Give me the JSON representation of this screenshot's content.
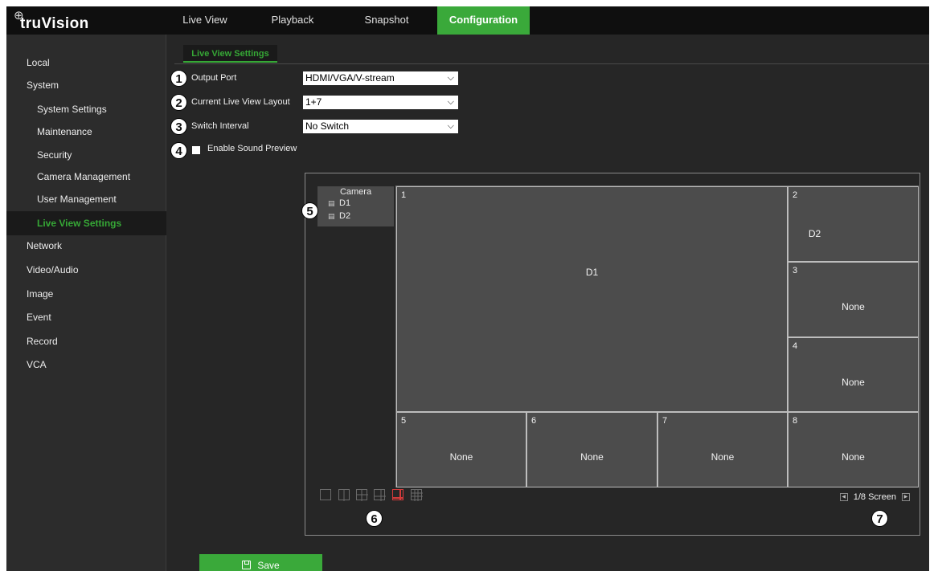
{
  "app": {
    "logo_text": "truVision"
  },
  "nav": {
    "tabs": [
      {
        "label": "Live View"
      },
      {
        "label": "Playback"
      },
      {
        "label": "Snapshot"
      },
      {
        "label": "Configuration",
        "active": true
      }
    ]
  },
  "sidebar": {
    "items": [
      {
        "label": "Local",
        "level": "top"
      },
      {
        "label": "System",
        "level": "top"
      },
      {
        "label": "System Settings",
        "level": "sub"
      },
      {
        "label": "Maintenance",
        "level": "sub"
      },
      {
        "label": "Security",
        "level": "sub"
      },
      {
        "label": "Camera Management",
        "level": "sub"
      },
      {
        "label": "User Management",
        "level": "sub"
      },
      {
        "label": "Live View Settings",
        "level": "sub",
        "active": true
      },
      {
        "label": "Network",
        "level": "top"
      },
      {
        "label": "Video/Audio",
        "level": "top"
      },
      {
        "label": "Image",
        "level": "top"
      },
      {
        "label": "Event",
        "level": "top"
      },
      {
        "label": "Record",
        "level": "top"
      },
      {
        "label": "VCA",
        "level": "top"
      }
    ]
  },
  "content": {
    "tab_label": "Live View Settings",
    "fields": {
      "output_port": {
        "label": "Output Port",
        "value": "HDMI/VGA/V-stream"
      },
      "layout": {
        "label": "Current Live View Layout",
        "value": "1+7"
      },
      "switch_interval": {
        "label": "Switch Interval",
        "value": "No Switch"
      }
    },
    "sound_preview": {
      "label": "Enable Sound Preview",
      "checked": false
    },
    "camera_list": {
      "header": "Camera",
      "items": [
        "D1",
        "D2"
      ]
    },
    "windows": [
      {
        "num": "1",
        "camera": "D1"
      },
      {
        "num": "2",
        "camera": "D2"
      },
      {
        "num": "3",
        "camera": "None"
      },
      {
        "num": "4",
        "camera": "None"
      },
      {
        "num": "5",
        "camera": "None"
      },
      {
        "num": "6",
        "camera": "None"
      },
      {
        "num": "7",
        "camera": "None"
      },
      {
        "num": "8",
        "camera": "None"
      }
    ],
    "layout_icons": [
      "layout-1x1-icon",
      "layout-1x2-icon",
      "layout-2x2-icon",
      "layout-1plus5-icon",
      "layout-1plus7-icon",
      "layout-3x3-icon"
    ],
    "active_layout_index": 4,
    "pager": {
      "text": "1/8 Screen"
    },
    "save_label": "Save"
  },
  "callouts": [
    "1",
    "2",
    "3",
    "4",
    "5",
    "6",
    "7"
  ],
  "colors": {
    "accent": "#3aa93a",
    "background": "#262626",
    "topbar": "#0f0f0f",
    "active_layout": "#d43b3b"
  }
}
